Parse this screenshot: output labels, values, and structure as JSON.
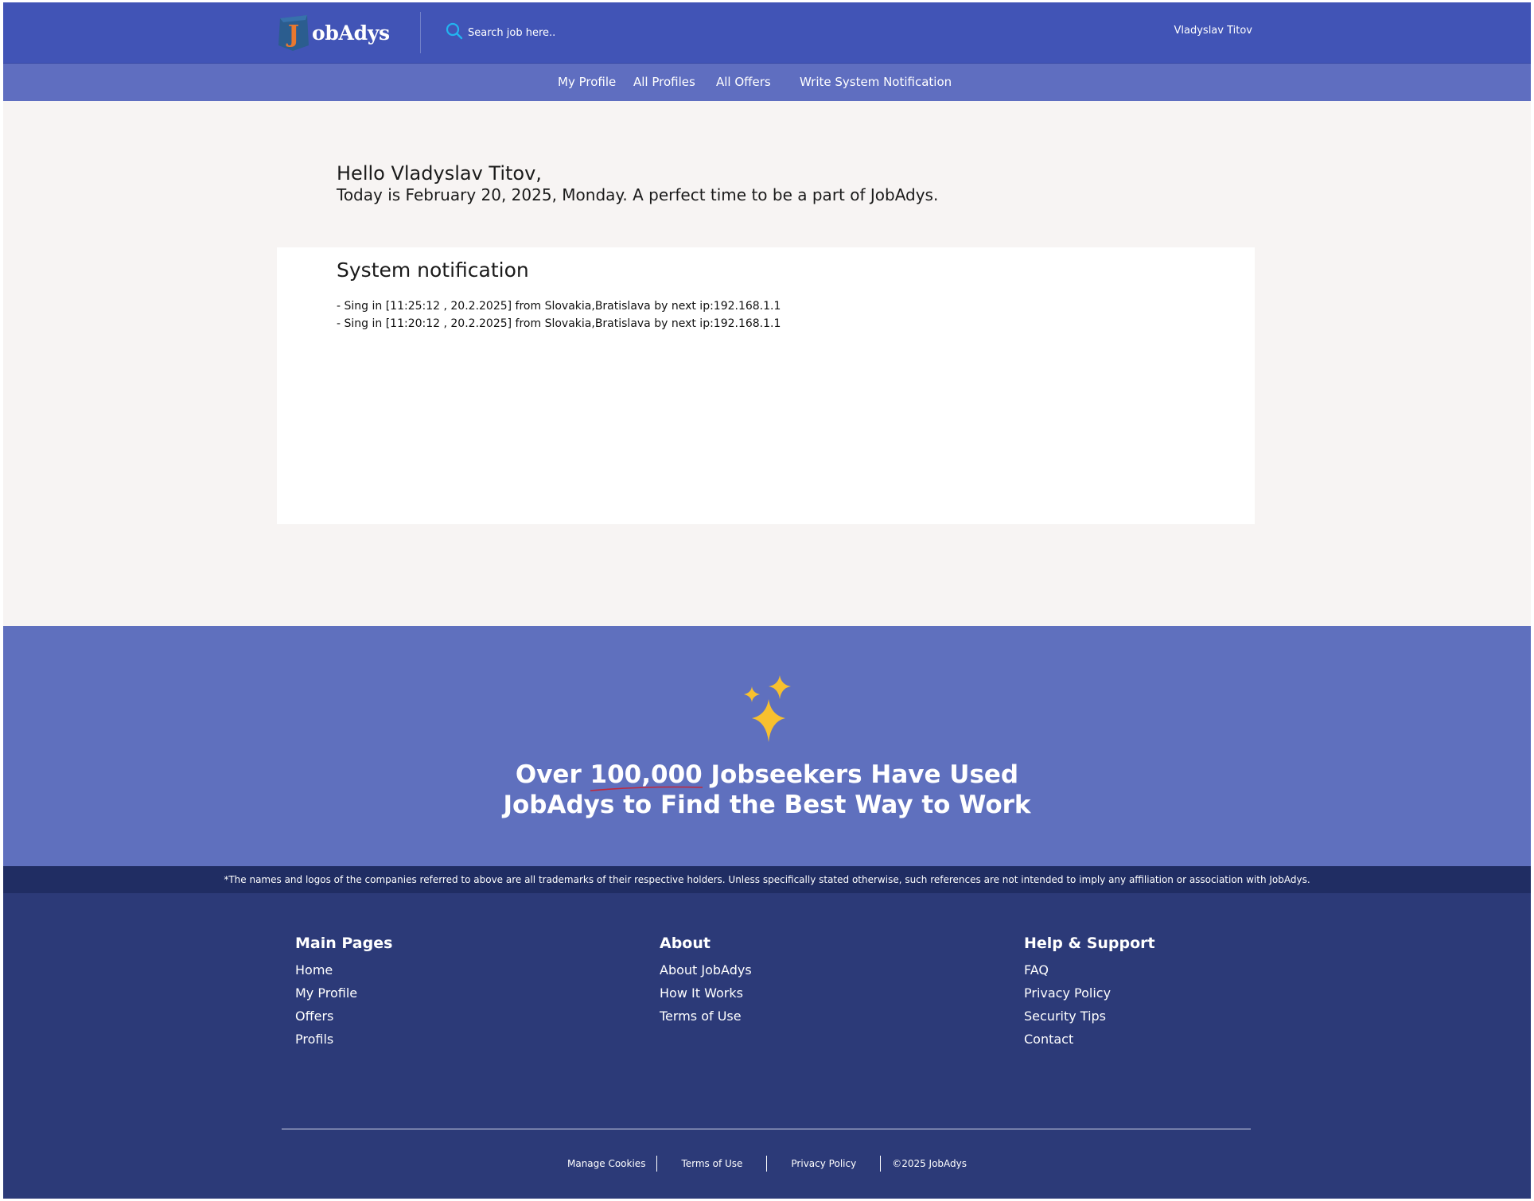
{
  "colors": {
    "header": "#4154b6",
    "navbar": "#5f6ec0",
    "promo": "#5f70be",
    "footer": "#2c3a78",
    "disclaimer_bar": "#202d63",
    "accent_star": "#f7c02f"
  },
  "header": {
    "logo_letter": "J",
    "logo_text": "obAdys",
    "search_placeholder": "Search job here..",
    "user_name": "Vladyslav Titov"
  },
  "nav": {
    "items": [
      {
        "label": "My Profile"
      },
      {
        "label": "All Profiles"
      },
      {
        "label": "All Offers"
      },
      {
        "label": "Write System Notification"
      }
    ]
  },
  "greeting": {
    "hello": "Hello Vladyslav Titov,",
    "date_line": "Today is February 20, 2025, Monday. A perfect time to be a part of JobAdys."
  },
  "notifications": {
    "title": "System notification",
    "lines": [
      "- Sing in [11:25:12 , 20.2.2025] from Slovakia,Bratislava by next ip:192.168.1.1",
      "- Sing in [11:20:12 , 20.2.2025] from Slovakia,Bratislava by next ip:192.168.1.1"
    ]
  },
  "promo": {
    "line1_pre": "Over ",
    "line1_highlight": "100,000",
    "line1_post": " Jobseekers Have Used",
    "line2": "JobAdys to Find the Best Way to Work",
    "icon": "sparkles-icon"
  },
  "disclaimer": "*The names and logos of the companies referred to above are all trademarks of their respective holders. Unless specifically stated otherwise, such references are not intended to imply any affiliation or association with JobAdys.",
  "footer": {
    "columns": [
      {
        "title": "Main Pages",
        "links": [
          "Home",
          "My Profile",
          "Offers",
          "Profils"
        ]
      },
      {
        "title": "About",
        "links": [
          "About JobAdys",
          "How It Works",
          "Terms of Use"
        ]
      },
      {
        "title": "Help & Support",
        "links": [
          "FAQ",
          "Privacy Policy",
          "Security Tips",
          "Contact"
        ]
      }
    ],
    "bottom": {
      "manage_cookies": "Manage Cookies",
      "terms": "Terms of Use",
      "privacy": "Privacy Policy",
      "copyright": "©2025 JobAdys"
    }
  }
}
